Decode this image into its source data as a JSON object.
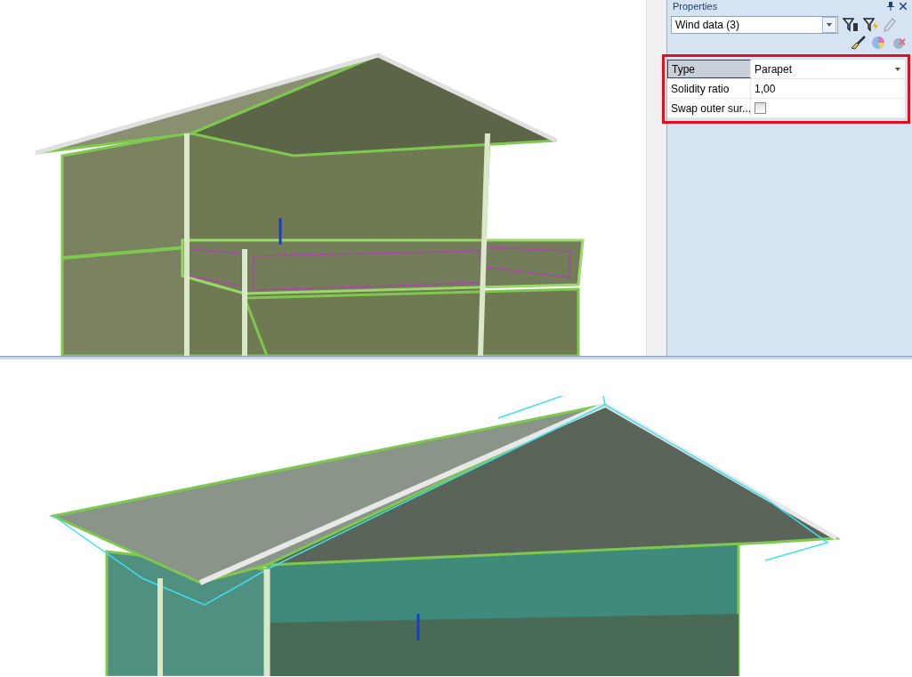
{
  "properties": {
    "title": "Properties",
    "object_selector": {
      "value": "Wind data (3)"
    },
    "rows": [
      {
        "kind": "dropdown",
        "label": "Type",
        "value": "Parapet",
        "selected": true
      },
      {
        "kind": "text",
        "label": "Solidity ratio",
        "value": "1,00",
        "selected": false
      },
      {
        "kind": "checkbox",
        "label": "Swap outer sur...",
        "checked": false,
        "selected": false
      }
    ]
  }
}
